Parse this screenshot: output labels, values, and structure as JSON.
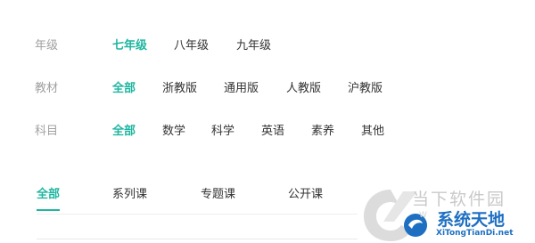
{
  "filters": {
    "grade": {
      "label": "年级",
      "options": [
        "七年级",
        "八年级",
        "九年级"
      ]
    },
    "textbook": {
      "label": "教材",
      "options": [
        "全部",
        "浙教版",
        "通用版",
        "人教版",
        "沪教版"
      ]
    },
    "subject": {
      "label": "科目",
      "options": [
        "全部",
        "数学",
        "科学",
        "英语",
        "素养",
        "其他"
      ]
    }
  },
  "tabs": [
    "全部",
    "系列课",
    "专题课",
    "公开课"
  ],
  "watermark": {
    "line1": "当下软件园",
    "line1_sub": "W",
    "line2": "系统天地",
    "url": "XiTongTianDi.net"
  },
  "colors": {
    "accent": "#1fb5a0",
    "label": "#a0a0a0",
    "text": "#333333",
    "brand_blue": "#1e6fc2"
  }
}
